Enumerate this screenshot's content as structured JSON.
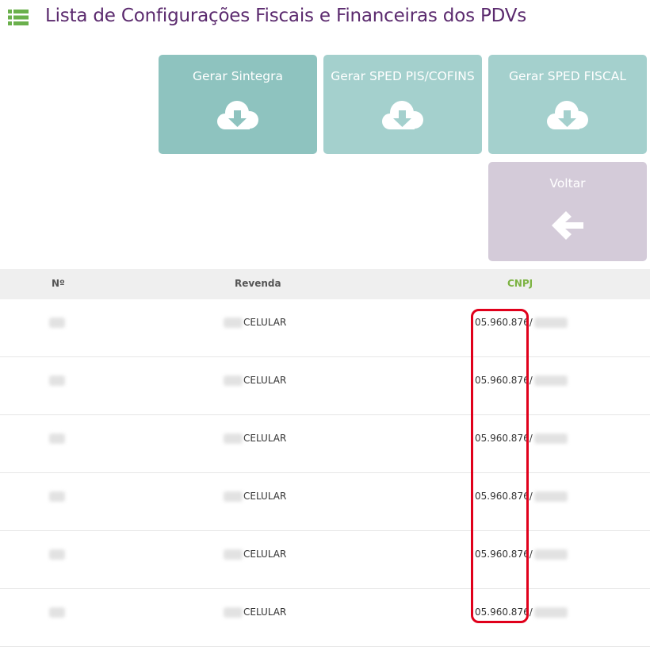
{
  "header": {
    "title": "Lista de Configurações Fiscais e Financeiras dos PDVs",
    "icon": "list-icon"
  },
  "actions": {
    "sintegra": {
      "label": "Gerar Sintegra",
      "icon": "cloud-download-icon"
    },
    "sped_pis_cofins": {
      "label": "Gerar SPED PIS/COFINS",
      "icon": "cloud-download-icon"
    },
    "sped_fiscal": {
      "label": "Gerar SPED FISCAL",
      "icon": "cloud-download-icon"
    },
    "voltar": {
      "label": "Voltar",
      "icon": "arrow-left-icon"
    }
  },
  "table": {
    "columns": {
      "num": "Nº",
      "revenda": "Revenda",
      "cnpj": "CNPJ"
    },
    "rows": [
      {
        "revenda": "CELULAR",
        "cnpj": "05.960.876/"
      },
      {
        "revenda": "CELULAR",
        "cnpj": "05.960.876/"
      },
      {
        "revenda": "CELULAR",
        "cnpj": "05.960.876/"
      },
      {
        "revenda": "CELULAR",
        "cnpj": "05.960.876/"
      },
      {
        "revenda": "CELULAR",
        "cnpj": "05.960.876/"
      },
      {
        "revenda": "CELULAR",
        "cnpj": "05.960.876/"
      }
    ]
  },
  "colors": {
    "title": "#5b2a6e",
    "list_icon": "#6ab04c",
    "btn_primary": "#8ec3bf",
    "btn_secondary": "#a4d0cd",
    "btn_back": "#d4cbd9",
    "cnpj_header": "#7cb342",
    "highlight": "#e0001b"
  }
}
